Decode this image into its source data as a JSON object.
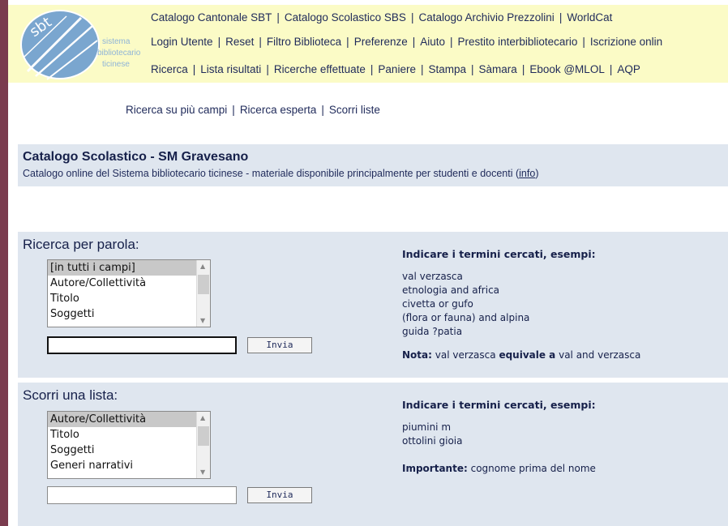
{
  "header": {
    "logo_text": [
      "sistema",
      "bibliotecario",
      "ticinese"
    ],
    "logo_mark": "sbt",
    "row1": [
      "Catalogo Cantonale SBT",
      "Catalogo Scolastico SBS",
      "Catalogo Archivio Prezzolini",
      "WorldCat"
    ],
    "row2": [
      "Login Utente",
      "Reset",
      "Filtro Biblioteca",
      "Preferenze",
      "Aiuto",
      "Prestito interbibliotecario",
      "Iscrizione onlin"
    ],
    "row3": [
      "Ricerca",
      "Lista risultati",
      "Ricerche effettuate",
      "Paniere",
      "Stampa",
      "Sàmara",
      "Ebook @MLOL",
      "AQP"
    ]
  },
  "subnav": [
    "Ricerca su più campi",
    "Ricerca esperta",
    "Scorri liste"
  ],
  "catalog": {
    "title": "Catalogo Scolastico - SM Gravesano",
    "description": "Catalogo online del Sistema bibliotecario ticinese - materiale disponibile principalmente per studenti e docenti (",
    "info_link": "info",
    "description_end": ")"
  },
  "search_word": {
    "title": "Ricerca per parola:",
    "options": [
      "[in tutti i campi]",
      "Autore/Collettività",
      "Titolo",
      "Soggetti"
    ],
    "selected_index": 0,
    "input_value": "",
    "submit_label": "Invia",
    "help_title": "Indicare i termini cercati, esempi:",
    "examples": [
      "val verzasca",
      "etnologia and africa",
      "civetta or gufo",
      "(flora or fauna) and alpina",
      "guida ?patia"
    ],
    "note_label": "Nota:",
    "note_text1": " val verzasca ",
    "note_bold": "equivale a",
    "note_text2": " val and verzasca"
  },
  "browse_list": {
    "title": "Scorri una lista:",
    "options": [
      "Autore/Collettività",
      "Titolo",
      "Soggetti",
      "Generi narrativi"
    ],
    "selected_index": 0,
    "input_value": "",
    "submit_label": "Invia",
    "help_title": "Indicare i termini cercati, esempi:",
    "examples": [
      "piumini m",
      "ottolini gioia"
    ],
    "note_label": "Importante:",
    "note_text": " cognome prima del nome"
  },
  "colors": {
    "border": "#7a3b4e",
    "header_bg": "#fbfbc6",
    "panel_bg": "#dfe6ef",
    "link": "#1f2a5a"
  }
}
